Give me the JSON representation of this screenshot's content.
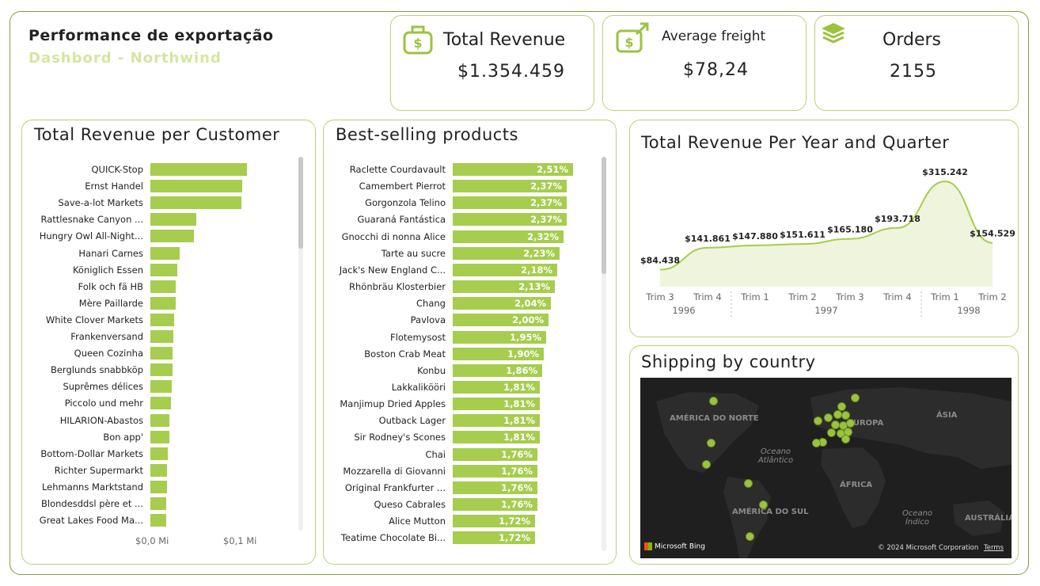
{
  "header": {
    "title": "Performance de exportação",
    "subtitle": "Dashbord - Northwind"
  },
  "kpis": {
    "total_revenue": {
      "label": "Total Revenue",
      "value": "$1.354.459",
      "icon": "money-bag-icon"
    },
    "average_freight": {
      "label": "Average freight",
      "value": "$78,24",
      "icon": "dollar-arrow-icon"
    },
    "orders": {
      "label": "Orders",
      "value": "2155",
      "icon": "layers-icon"
    }
  },
  "colors": {
    "accent": "#a6cd4d",
    "border": "#b9d27a",
    "map_bg": "#1f1f1f"
  },
  "customers": {
    "title": "Total Revenue per Customer",
    "axis": [
      "$0,0 Mi",
      "$0,1 Mi"
    ],
    "items": [
      {
        "label": "QUICK-Stop",
        "value": 0.11
      },
      {
        "label": "Ernst Handel",
        "value": 0.105
      },
      {
        "label": "Save-a-lot Markets",
        "value": 0.104
      },
      {
        "label": "Rattlesnake Canyon ...",
        "value": 0.052
      },
      {
        "label": "Hungry Owl All-Night...",
        "value": 0.05
      },
      {
        "label": "Hanari Carnes",
        "value": 0.033
      },
      {
        "label": "Königlich Essen",
        "value": 0.031
      },
      {
        "label": "Folk och fä HB",
        "value": 0.029
      },
      {
        "label": "Mère Paillarde",
        "value": 0.029
      },
      {
        "label": "White Clover Markets",
        "value": 0.027
      },
      {
        "label": "Frankenversand",
        "value": 0.026
      },
      {
        "label": "Queen Cozinha",
        "value": 0.025
      },
      {
        "label": "Berglunds snabbköp",
        "value": 0.025
      },
      {
        "label": "Suprêmes délices",
        "value": 0.024
      },
      {
        "label": "Piccolo und mehr",
        "value": 0.023
      },
      {
        "label": "HILARION-Abastos",
        "value": 0.022
      },
      {
        "label": "Bon app'",
        "value": 0.022
      },
      {
        "label": "Bottom-Dollar Markets",
        "value": 0.02
      },
      {
        "label": "Richter Supermarkt",
        "value": 0.019
      },
      {
        "label": "Lehmanns Marktstand",
        "value": 0.019
      },
      {
        "label": "Blondesddsl père et ...",
        "value": 0.018
      },
      {
        "label": "Great Lakes Food Ma...",
        "value": 0.018
      }
    ]
  },
  "products": {
    "title": "Best-selling products",
    "items": [
      {
        "label": "Raclette Courdavault",
        "value": 2.51,
        "text": "2,51%"
      },
      {
        "label": "Camembert Pierrot",
        "value": 2.37,
        "text": "2,37%"
      },
      {
        "label": "Gorgonzola Telino",
        "value": 2.37,
        "text": "2,37%"
      },
      {
        "label": "Guaraná Fantástica",
        "value": 2.37,
        "text": "2,37%"
      },
      {
        "label": "Gnocchi di nonna Alice",
        "value": 2.32,
        "text": "2,32%"
      },
      {
        "label": "Tarte au sucre",
        "value": 2.23,
        "text": "2,23%"
      },
      {
        "label": "Jack's New England C...",
        "value": 2.18,
        "text": "2,18%"
      },
      {
        "label": "Rhönbräu Klosterbier",
        "value": 2.13,
        "text": "2,13%"
      },
      {
        "label": "Chang",
        "value": 2.04,
        "text": "2,04%"
      },
      {
        "label": "Pavlova",
        "value": 2.0,
        "text": "2,00%"
      },
      {
        "label": "Flotemysost",
        "value": 1.95,
        "text": "1,95%"
      },
      {
        "label": "Boston Crab Meat",
        "value": 1.9,
        "text": "1,90%"
      },
      {
        "label": "Konbu",
        "value": 1.86,
        "text": "1,86%"
      },
      {
        "label": "Lakkalikööri",
        "value": 1.81,
        "text": "1,81%"
      },
      {
        "label": "Manjimup Dried Apples",
        "value": 1.81,
        "text": "1,81%"
      },
      {
        "label": "Outback Lager",
        "value": 1.81,
        "text": "1,81%"
      },
      {
        "label": "Sir Rodney's Scones",
        "value": 1.81,
        "text": "1,81%"
      },
      {
        "label": "Chai",
        "value": 1.76,
        "text": "1,76%"
      },
      {
        "label": "Mozzarella di Giovanni",
        "value": 1.76,
        "text": "1,76%"
      },
      {
        "label": "Original Frankfurter ...",
        "value": 1.76,
        "text": "1,76%"
      },
      {
        "label": "Queso Cabrales",
        "value": 1.76,
        "text": "1,76%"
      },
      {
        "label": "Alice Mutton",
        "value": 1.72,
        "text": "1,72%"
      },
      {
        "label": "Teatime Chocolate Bi...",
        "value": 1.72,
        "text": "1,72%"
      }
    ]
  },
  "chart_data": {
    "type": "area",
    "title": "Total Revenue Per Year and Quarter",
    "x": [
      "Trim 3",
      "Trim 4",
      "Trim 1",
      "Trim 2",
      "Trim 3",
      "Trim 4",
      "Trim 1",
      "Trim 2"
    ],
    "years": [
      {
        "label": "1996",
        "span": [
          0,
          1
        ]
      },
      {
        "label": "1997",
        "span": [
          2,
          5
        ]
      },
      {
        "label": "1998",
        "span": [
          6,
          7
        ]
      }
    ],
    "values": [
      84438,
      141861,
      147880,
      151611,
      165180,
      193718,
      315242,
      154529
    ],
    "labels": [
      "$84.438",
      "$141.861",
      "$147.880",
      "$151.611",
      "$165.180",
      "$193.718",
      "$315.242",
      "$154.529"
    ],
    "ylim": [
      40000,
      330000
    ]
  },
  "map": {
    "title": "Shipping by country",
    "labels": [
      "AMÉRICA DO NORTE",
      "ÁSIA",
      "EUROPA",
      "Oceano Atlântico",
      "ÁFRICA",
      "AMÉRICA DO SUL",
      "Oceano Índico",
      "AUSTRÁLIA"
    ],
    "attribution": "Microsoft Bing",
    "copyright": "© 2024 Microsoft Corporation",
    "terms": "Terms"
  }
}
